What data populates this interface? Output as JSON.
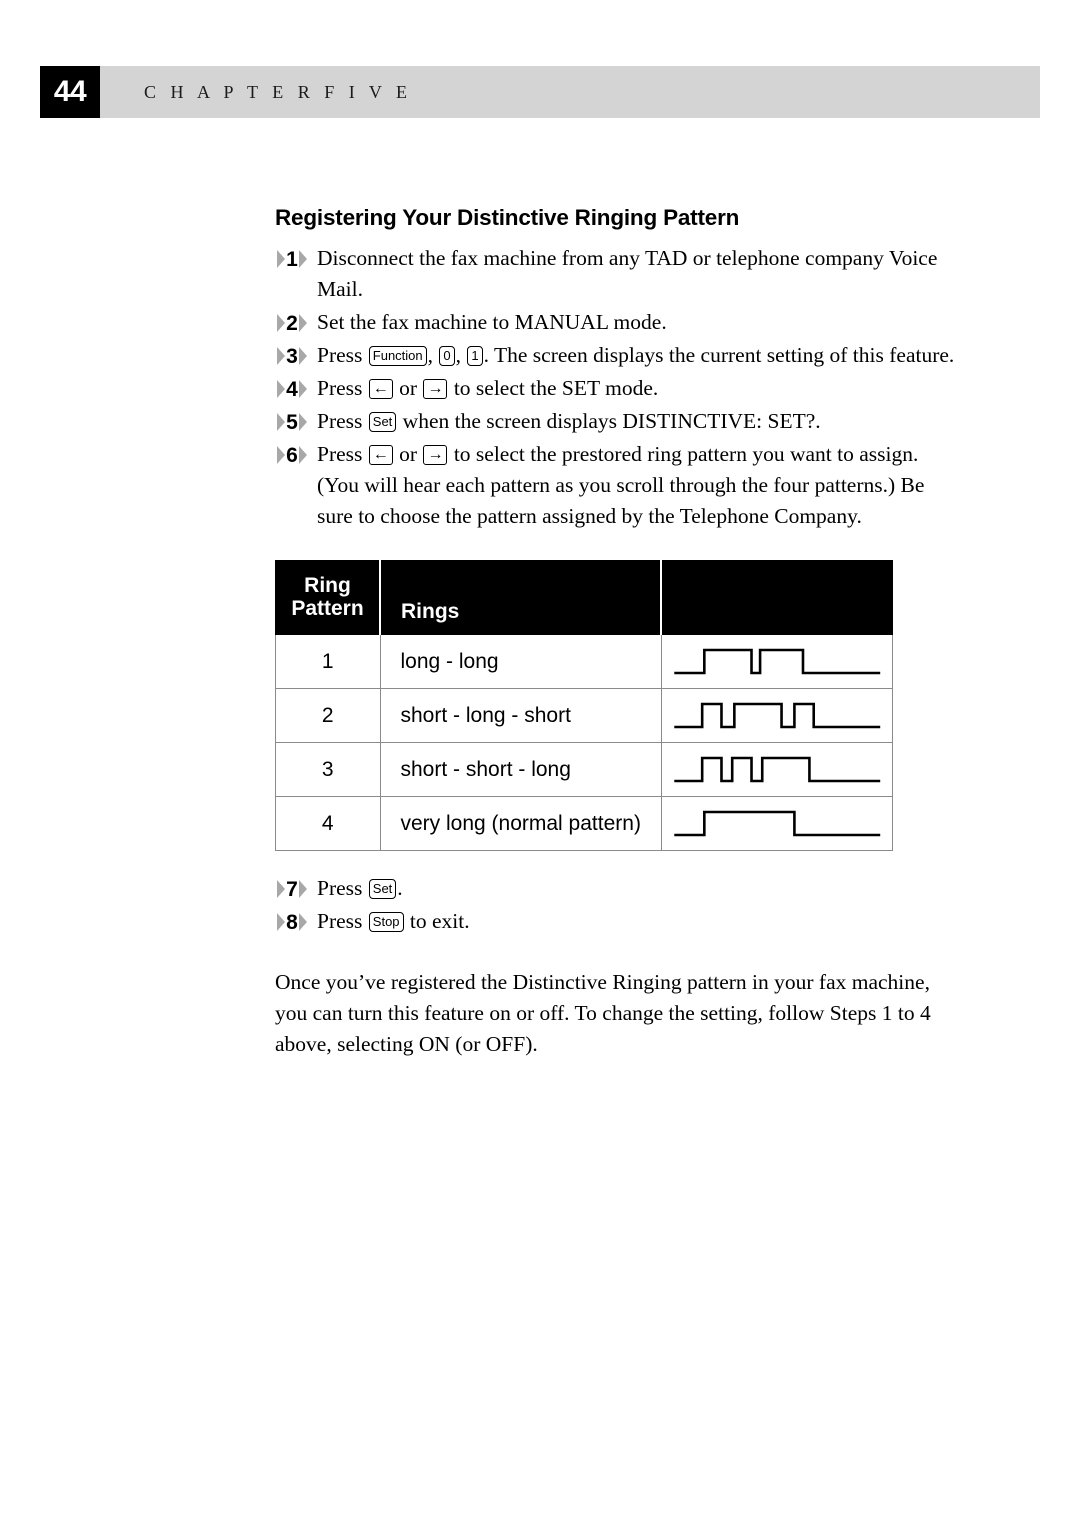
{
  "header": {
    "page_number": "44",
    "chapter_label": "C H A P T E R   F I V E"
  },
  "section": {
    "title": "Registering Your Distinctive Ringing Pattern"
  },
  "steps": [
    {
      "number": "1",
      "parts": [
        {
          "type": "text",
          "value": "Disconnect the fax machine from any TAD or telephone company Voice Mail."
        }
      ]
    },
    {
      "number": "2",
      "parts": [
        {
          "type": "text",
          "value": "Set the fax machine to MANUAL mode."
        }
      ]
    },
    {
      "number": "3",
      "parts": [
        {
          "type": "text",
          "value": "Press "
        },
        {
          "type": "key",
          "value": "Function"
        },
        {
          "type": "text",
          "value": ", "
        },
        {
          "type": "key",
          "value": "0"
        },
        {
          "type": "text",
          "value": ", "
        },
        {
          "type": "key",
          "value": "1"
        },
        {
          "type": "text",
          "value": ".  The screen displays the current setting of this feature."
        }
      ]
    },
    {
      "number": "4",
      "parts": [
        {
          "type": "text",
          "value": "Press "
        },
        {
          "type": "arrow-key",
          "value": "←"
        },
        {
          "type": "text",
          "value": " or "
        },
        {
          "type": "arrow-key",
          "value": "→"
        },
        {
          "type": "text",
          "value": " to select the SET mode."
        }
      ]
    },
    {
      "number": "5",
      "parts": [
        {
          "type": "text",
          "value": "Press "
        },
        {
          "type": "key",
          "value": "Set"
        },
        {
          "type": "text",
          "value": " when the screen displays DISTINCTIVE: SET?."
        }
      ]
    },
    {
      "number": "6",
      "parts": [
        {
          "type": "text",
          "value": "Press "
        },
        {
          "type": "arrow-key",
          "value": "←"
        },
        {
          "type": "text",
          "value": " or "
        },
        {
          "type": "arrow-key",
          "value": "→"
        },
        {
          "type": "text",
          "value": " to select the prestored ring pattern you want to assign. (You will hear each pattern as you scroll through the four patterns.) Be sure to choose the pattern assigned by the Telephone Company."
        }
      ]
    }
  ],
  "steps_after": [
    {
      "number": "7",
      "parts": [
        {
          "type": "text",
          "value": "Press "
        },
        {
          "type": "key",
          "value": "Set"
        },
        {
          "type": "text",
          "value": "."
        }
      ]
    },
    {
      "number": "8",
      "parts": [
        {
          "type": "text",
          "value": "Press "
        },
        {
          "type": "key",
          "value": "Stop"
        },
        {
          "type": "text",
          "value": " to exit."
        }
      ]
    }
  ],
  "ring_table": {
    "headers": [
      "Ring\nPattern",
      "Rings",
      ""
    ],
    "header_pattern_line1": "Ring",
    "header_pattern_line2": "Pattern",
    "header_rings": "Rings",
    "header_wave": "",
    "rows": [
      {
        "pattern": "1",
        "rings": "long - long",
        "waveform": "long-long",
        "pulses": [
          [
            16,
            38
          ],
          [
            42,
            62
          ]
        ]
      },
      {
        "pattern": "2",
        "rings": "short - long - short",
        "waveform": "short-long-short",
        "pulses": [
          [
            15,
            24
          ],
          [
            30,
            52
          ],
          [
            58,
            67
          ]
        ]
      },
      {
        "pattern": "3",
        "rings": "short - short - long",
        "waveform": "short-short-long",
        "pulses": [
          [
            15,
            24
          ],
          [
            29,
            38
          ],
          [
            43,
            65
          ]
        ]
      },
      {
        "pattern": "4",
        "rings": "very long (normal pattern)",
        "waveform": "very-long",
        "pulses": [
          [
            16,
            58
          ]
        ]
      }
    ]
  },
  "closing": {
    "text": "Once you’ve registered the Distinctive Ringing pattern in your fax machine, you can turn this feature on or off.  To change the setting, follow Steps 1 to 4 above, selecting ON (or OFF)."
  },
  "colors": {
    "page_number_bg": "#000000",
    "chapter_bar_bg": "#d4d4d4",
    "table_header_bg": "#000000",
    "marker_wing": "#a8a8a8",
    "text": "#000000"
  }
}
